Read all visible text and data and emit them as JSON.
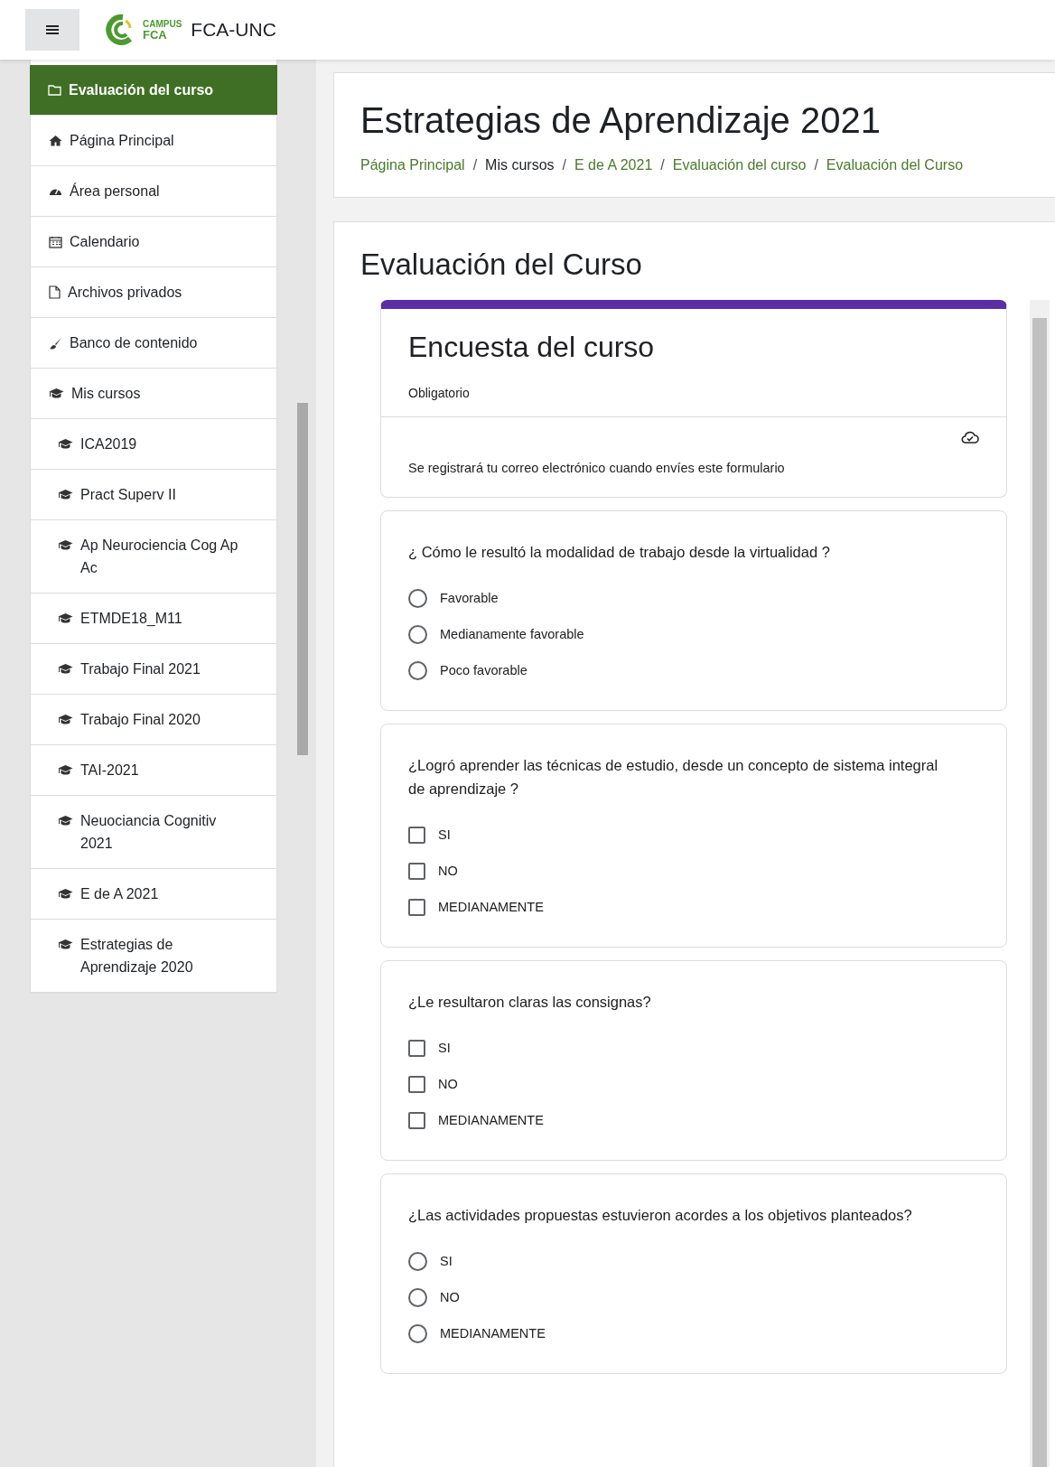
{
  "header": {
    "brand_badge": "CAMPUS",
    "brand_short": "FCA",
    "site_name": "FCA-UNC"
  },
  "sidebar": {
    "items": [
      {
        "label": "Evaluación del curso",
        "kind": "folder",
        "selected": true,
        "nested": false
      },
      {
        "label": "Página Principal",
        "kind": "home",
        "selected": false,
        "nested": false
      },
      {
        "label": "Área personal",
        "kind": "dashboard",
        "selected": false,
        "nested": false
      },
      {
        "label": "Calendario",
        "kind": "calendar",
        "selected": false,
        "nested": false
      },
      {
        "label": "Archivos privados",
        "kind": "file",
        "selected": false,
        "nested": false
      },
      {
        "label": "Banco de contenido",
        "kind": "brush",
        "selected": false,
        "nested": false
      },
      {
        "label": "Mis cursos",
        "kind": "cap",
        "selected": false,
        "nested": false
      },
      {
        "label": "ICA2019",
        "kind": "cap",
        "selected": false,
        "nested": true
      },
      {
        "label": "Pract Superv II",
        "kind": "cap",
        "selected": false,
        "nested": true
      },
      {
        "label": "Ap Neurociencia Cog Ap Ac",
        "kind": "cap",
        "selected": false,
        "nested": true
      },
      {
        "label": "ETMDE18_M11",
        "kind": "cap",
        "selected": false,
        "nested": true
      },
      {
        "label": "Trabajo Final 2021",
        "kind": "cap",
        "selected": false,
        "nested": true
      },
      {
        "label": "Trabajo Final 2020",
        "kind": "cap",
        "selected": false,
        "nested": true
      },
      {
        "label": "TAI-2021",
        "kind": "cap",
        "selected": false,
        "nested": true
      },
      {
        "label": "Neuociancia Cognitiv 2021",
        "kind": "cap",
        "selected": false,
        "nested": true
      },
      {
        "label": "E de A 2021",
        "kind": "cap",
        "selected": false,
        "nested": true
      },
      {
        "label": "Estrategias de Aprendizaje 2020",
        "kind": "cap",
        "selected": false,
        "nested": true
      }
    ]
  },
  "page_title": "Estrategias de Aprendizaje 2021",
  "breadcrumb": [
    {
      "label": "Página Principal",
      "link": true
    },
    {
      "separator": "/",
      "label": "Mis cursos",
      "link": false
    },
    {
      "separator": "/",
      "label": "E de A 2021",
      "link": true
    },
    {
      "separator": "/",
      "label": "Evaluación del curso",
      "link": true
    },
    {
      "separator": "/",
      "label": "Evaluación del Curso",
      "link": true
    }
  ],
  "activity_title": "Evaluación del Curso",
  "form": {
    "title": "Encuesta del curso",
    "required_note": "Obligatorio",
    "email_notice": "Se registrará tu correo electrónico cuando envíes este formulario",
    "questions": [
      {
        "text": "¿ Cómo le resultó la modalidad de trabajo desde la virtualidad ?",
        "kind": "radio",
        "options": [
          {
            "label": "Favorable",
            "checked": false
          },
          {
            "label": "Medianamente favorable",
            "checked": false
          },
          {
            "label": "Poco favorable",
            "checked": false
          }
        ]
      },
      {
        "text": "¿Logró aprender las técnicas de estudio, desde un concepto de sistema integral de aprendizaje ?",
        "kind": "checkbox",
        "options": [
          {
            "label": "SI",
            "checked": false
          },
          {
            "label": "NO",
            "checked": false
          },
          {
            "label": "MEDIANAMENTE",
            "checked": false
          }
        ]
      },
      {
        "text": "¿Le resultaron claras las consignas?",
        "kind": "checkbox",
        "options": [
          {
            "label": "SI",
            "checked": false
          },
          {
            "label": "NO",
            "checked": false
          },
          {
            "label": "MEDIANAMENTE",
            "checked": false
          }
        ]
      },
      {
        "text": "¿Las actividades propuestas estuvieron acordes a los objetivos planteados?",
        "kind": "radio",
        "options": [
          {
            "label": "SI",
            "checked": false
          },
          {
            "label": "NO",
            "checked": false
          },
          {
            "label": "MEDIANAMENTE",
            "checked": false
          }
        ]
      }
    ]
  }
}
